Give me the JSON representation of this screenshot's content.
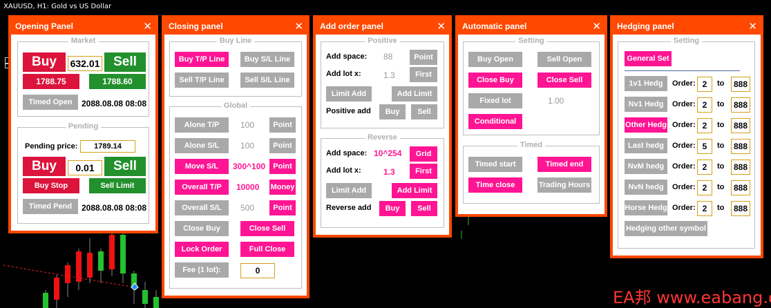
{
  "chart": {
    "title": "XAUUSD, H1:  Gold vs US Dollar"
  },
  "colors": {
    "panel": "#ff4800",
    "pink": "#ff1493",
    "grey": "#a9a9a9",
    "red": "#dc143c",
    "green": "#22902c"
  },
  "opening": {
    "title": "Opening Panel",
    "market_legend": "Market",
    "buy": "Buy",
    "lot": "632.01",
    "sell": "Sell",
    "buy_price": "1788.75",
    "sell_price": "1788.60",
    "timed_open": "Timed Open",
    "timed_open_time": "2088.08.08 08:08",
    "pending_legend": "Pending",
    "pending_price_label": "Pending price:",
    "pending_price": "1789.14",
    "p_buy": "Buy",
    "p_lot": "0.01",
    "p_sell": "Sell",
    "buy_stop": "Buy Stop",
    "sell_limit": "Sell Limit",
    "timed_pend": "Timed Pend",
    "timed_pend_time": "2088.08.08 08:08"
  },
  "closing": {
    "title": "Closing panel",
    "buyline_legend": "Buy Line",
    "buy_tp_line": "Buy T/P Line",
    "buy_sl_line": "Buy S/L Line",
    "sell_tp_line": "Sell T/P Line",
    "sell_sl_line": "Sell S/L Line",
    "global_legend": "Global",
    "alone_tp": "Alone T/P",
    "alone_tp_val": "100",
    "alone_tp_unit": "Point",
    "alone_sl": "Alone S/L",
    "alone_sl_val": "100",
    "alone_sl_unit": "Point",
    "move_sl": "Move S/L",
    "move_sl_val": "300^100",
    "move_sl_unit": "Point",
    "overall_tp": "Overall T/P",
    "overall_tp_val": "10000",
    "overall_tp_unit": "Money",
    "overall_sl": "Overall S/L",
    "overall_sl_val": "500",
    "overall_sl_unit": "Point",
    "close_buy": "Close Buy",
    "close_sell": "Close Sell",
    "lock_order": "Lock Order",
    "full_close": "Full Close",
    "fee": "Fee (1 lot):",
    "fee_val": "0"
  },
  "add_order": {
    "title": "Add order panel",
    "positive_legend": "Positive",
    "add_space": "Add space:",
    "pos_space_val": "88",
    "pos_space_unit": "Point",
    "add_lot": "Add lot x:",
    "pos_lot_val": "1.3",
    "pos_lot_unit": "First",
    "pos_limit_add": "Limit Add",
    "pos_add_limit": "Add Limit",
    "positive_add": "Positive add",
    "pos_buy": "Buy",
    "pos_sell": "Sell",
    "reverse_legend": "Reverse",
    "rev_space_val": "10^254",
    "rev_space_unit": "Grid",
    "rev_lot_val": "1.3",
    "rev_lot_unit": "First",
    "rev_limit_add": "Limit Add",
    "rev_add_limit": "Add Limit",
    "reverse_add": "Reverse add",
    "rev_buy": "Buy",
    "rev_sell": "Sell"
  },
  "automatic": {
    "title": "Automatic panel",
    "setting_legend": "Setting",
    "buy_open": "Buy Open",
    "sell_open": "Sell Open",
    "close_buy": "Close Buy",
    "close_sell": "Close Sell",
    "fixed_lot": "Fixed lot",
    "fixed_lot_val": "1.00",
    "conditional": "Conditional",
    "timed_legend": "Timed",
    "timed_start": "Timed start",
    "timed_end": "Timed end",
    "time_close": "Time close",
    "trading_hours": "Trading Hours"
  },
  "hedging": {
    "title": "Hedging panel",
    "setting_legend": "Setting",
    "general_set": "General Set",
    "order_label": "Order:",
    "to_label": "to",
    "rows": [
      {
        "name": "1v1 Hedg",
        "from": "2",
        "to": "888"
      },
      {
        "name": "Nv1 Hedg",
        "from": "2",
        "to": "888"
      },
      {
        "name": "Other Hedg",
        "from": "2",
        "to": "888"
      },
      {
        "name": "Last hedg",
        "from": "5",
        "to": "888"
      },
      {
        "name": "NvM hedg",
        "from": "2",
        "to": "888"
      },
      {
        "name": "NvN hedg",
        "from": "2",
        "to": "888"
      },
      {
        "name": "Horse Hedg",
        "from": "2",
        "to": "888"
      }
    ],
    "other_symbol": "Hedging other symbol"
  },
  "watermark": "EA邦 www.eabang.com"
}
